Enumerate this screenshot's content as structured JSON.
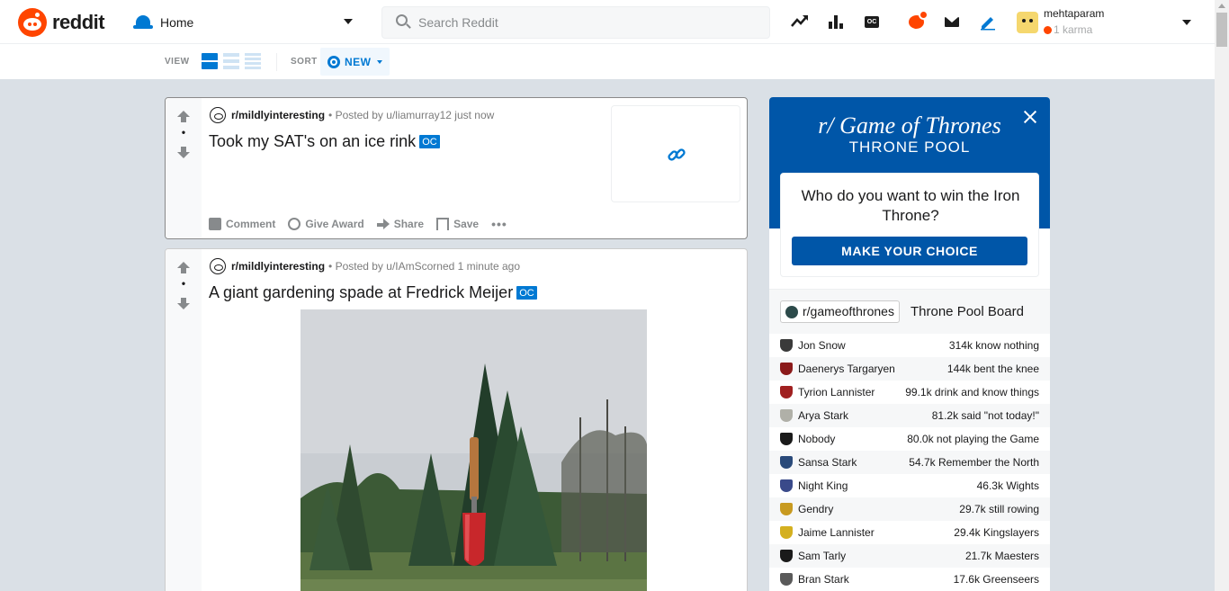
{
  "header": {
    "logo_text": "reddit",
    "home_label": "Home",
    "search_placeholder": "Search Reddit",
    "username": "mehtaparam",
    "karma": "1 karma"
  },
  "subbar": {
    "view_label": "VIEW",
    "sort_label": "SORT",
    "sort_value": "NEW"
  },
  "posts": [
    {
      "votes": "•",
      "subreddit": "r/mildlyinteresting",
      "posted": "• Posted by u/liamurray12 just now",
      "title": "Took my SAT's on an ice rink",
      "flair": "OC",
      "actions": {
        "comment": "Comment",
        "award": "Give Award",
        "share": "Share",
        "save": "Save",
        "more": "•••"
      }
    },
    {
      "votes": "•",
      "subreddit": "r/mildlyinteresting",
      "posted": "• Posted by u/IAmScorned 1 minute ago",
      "title": "A giant gardening spade at Fredrick Meijer",
      "flair": "OC"
    }
  ],
  "widget": {
    "title": "r/ Game of Thrones",
    "subtitle": "THRONE POOL",
    "question": "Who do you want to win the Iron Throne?",
    "button": "MAKE YOUR CHOICE",
    "board_sub": "r/gameofthrones",
    "board_title": "Throne Pool Board",
    "rows": [
      {
        "name": "Jon Snow",
        "stat": "314k know nothing",
        "color": "#3a3a3a"
      },
      {
        "name": "Daenerys Targaryen",
        "stat": "144k bent the knee",
        "color": "#8b1a1a"
      },
      {
        "name": "Tyrion Lannister",
        "stat": "99.1k drink and know things",
        "color": "#a02020"
      },
      {
        "name": "Arya Stark",
        "stat": "81.2k said \"not today!\"",
        "color": "#b0b0a8"
      },
      {
        "name": "Nobody",
        "stat": "80.0k not playing the Game",
        "color": "#1a1a1a"
      },
      {
        "name": "Sansa Stark",
        "stat": "54.7k Remember the North",
        "color": "#2a4a7a"
      },
      {
        "name": "Night King",
        "stat": "46.3k Wights",
        "color": "#3a4a8a"
      },
      {
        "name": "Gendry",
        "stat": "29.7k still rowing",
        "color": "#c89a20"
      },
      {
        "name": "Jaime Lannister",
        "stat": "29.4k Kingslayers",
        "color": "#d4b020"
      },
      {
        "name": "Sam Tarly",
        "stat": "21.7k Maesters",
        "color": "#1a1a1a"
      },
      {
        "name": "Bran Stark",
        "stat": "17.6k Greenseers",
        "color": "#5a5a5a"
      }
    ]
  }
}
